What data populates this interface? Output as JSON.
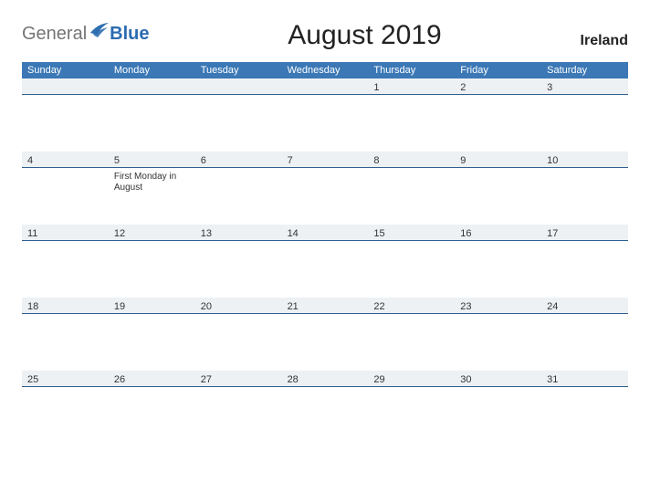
{
  "brand": {
    "general": "General",
    "blue": "Blue"
  },
  "title": "August 2019",
  "country": "Ireland",
  "weekdays": [
    "Sunday",
    "Monday",
    "Tuesday",
    "Wednesday",
    "Thursday",
    "Friday",
    "Saturday"
  ],
  "weeks": [
    [
      {
        "day": ""
      },
      {
        "day": ""
      },
      {
        "day": ""
      },
      {
        "day": ""
      },
      {
        "day": "1"
      },
      {
        "day": "2"
      },
      {
        "day": "3"
      }
    ],
    [
      {
        "day": "4"
      },
      {
        "day": "5",
        "event": "First Monday in August"
      },
      {
        "day": "6"
      },
      {
        "day": "7"
      },
      {
        "day": "8"
      },
      {
        "day": "9"
      },
      {
        "day": "10"
      }
    ],
    [
      {
        "day": "11"
      },
      {
        "day": "12"
      },
      {
        "day": "13"
      },
      {
        "day": "14"
      },
      {
        "day": "15"
      },
      {
        "day": "16"
      },
      {
        "day": "17"
      }
    ],
    [
      {
        "day": "18"
      },
      {
        "day": "19"
      },
      {
        "day": "20"
      },
      {
        "day": "21"
      },
      {
        "day": "22"
      },
      {
        "day": "23"
      },
      {
        "day": "24"
      }
    ],
    [
      {
        "day": "25"
      },
      {
        "day": "26"
      },
      {
        "day": "27"
      },
      {
        "day": "28"
      },
      {
        "day": "29"
      },
      {
        "day": "30"
      },
      {
        "day": "31"
      }
    ]
  ]
}
